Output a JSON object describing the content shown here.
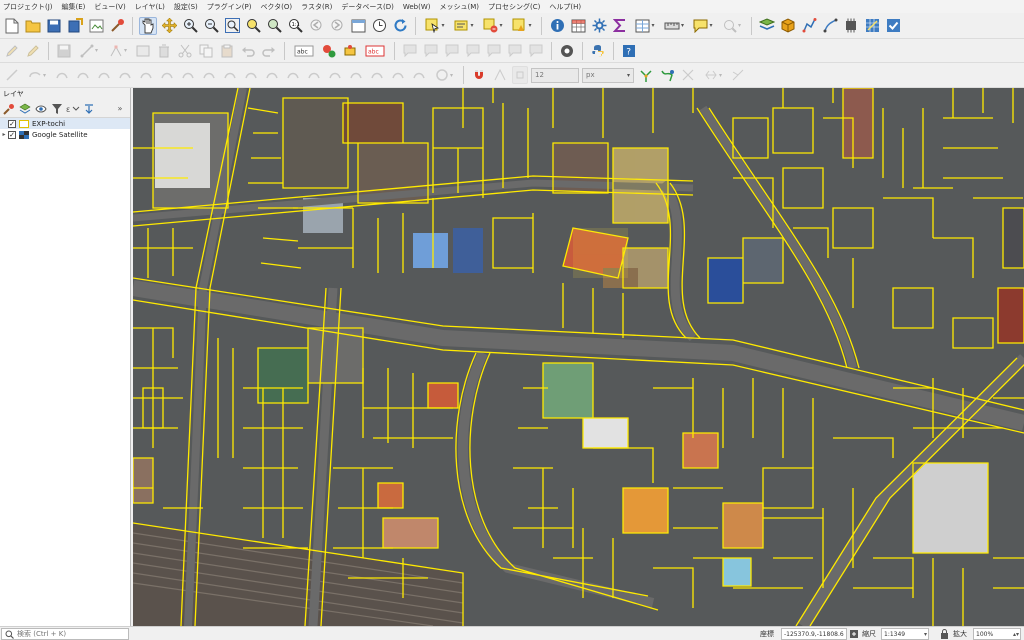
{
  "menubar": {
    "items": [
      "プロジェクト(J)",
      "編集(E)",
      "ビュー(V)",
      "レイヤ(L)",
      "設定(S)",
      "プラグイン(P)",
      "ベクタ(O)",
      "ラスタ(R)",
      "データベース(D)",
      "Web(W)",
      "メッシュ(M)",
      "プロセシング(C)",
      "ヘルプ(H)"
    ]
  },
  "digitizing": {
    "snap_tolerance": "12",
    "snap_unit": "px"
  },
  "layers_panel": {
    "title": "レイヤ",
    "layers": [
      {
        "name": "EXP-tochi",
        "checked": true,
        "selected": true
      },
      {
        "name": "Google Satellite",
        "checked": true,
        "selected": false
      }
    ]
  },
  "statusbar": {
    "locator_placeholder": "検索 (Ctrl + K)",
    "coordinate_label": "座標",
    "coordinate_value": "-125370.9,-11808.6",
    "scale_label": "縮尺",
    "scale_value": "1:1349",
    "magnifier_label": "拡大",
    "magnifier_value": "100%"
  },
  "icons": {
    "toolbar1": [
      "new-project-icon",
      "open-project-icon",
      "save-project-icon",
      "save-as-icon",
      "print-layout-icon",
      "style-manager-icon",
      "pan-icon",
      "pan-to-selection-icon",
      "zoom-in-icon",
      "zoom-out-icon",
      "zoom-full-icon",
      "zoom-to-selection-icon",
      "zoom-to-layer-icon",
      "zoom-native-icon",
      "zoom-last-icon",
      "zoom-next-icon",
      "new-map-view-icon",
      "temporal-controller-icon",
      "refresh-icon",
      "select-features-icon",
      "select-by-value-icon",
      "deselect-icon",
      "identify-icon",
      "attribute-table-icon",
      "processing-toolbox-icon",
      "statistics-icon",
      "field-calculator-icon",
      "measure-icon",
      "map-tips-icon",
      "add-vector-icon",
      "add-raster-icon",
      "digitize-icon",
      "plugin-icon",
      "check-geometry-icon"
    ],
    "toolbar3_tools": [
      "magnet-icon",
      "snap-vertex-icon",
      "snap-segment-icon",
      "trace-icon",
      "split-icon"
    ]
  },
  "colors": {
    "parcel_lines": "#ffea00",
    "selection_fill": "#d6e4f5"
  }
}
